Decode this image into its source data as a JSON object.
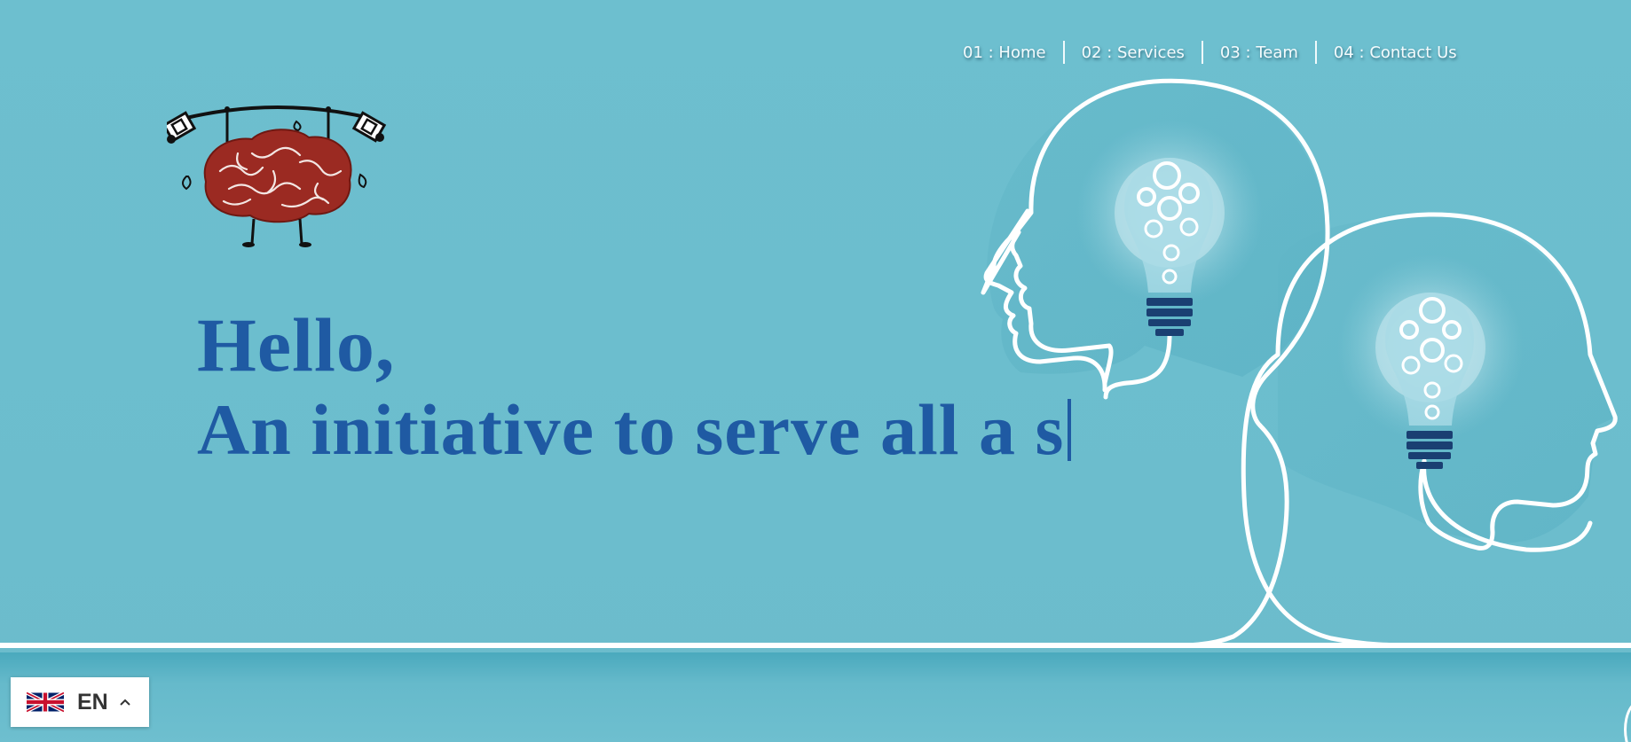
{
  "nav": {
    "items": [
      {
        "label": "01 : Home"
      },
      {
        "label": "02 : Services"
      },
      {
        "label": "03 : Team"
      },
      {
        "label": "04 : Contact Us"
      }
    ]
  },
  "logo": {
    "icon": "brain-lifting-barbell-icon"
  },
  "hero": {
    "line1": "Hello,",
    "line2": "An initiative to serve all a s"
  },
  "illustration": {
    "icon": "heads-with-lightbulbs-icon"
  },
  "language": {
    "code": "EN",
    "flag_icon": "uk-flag-icon",
    "toggle_icon": "chevron-up-icon"
  },
  "colors": {
    "background": "#6dbfcf",
    "headline": "#1f5aa3",
    "nav_text": "#f4fbfd",
    "logo_brain": "#9b2a22"
  }
}
